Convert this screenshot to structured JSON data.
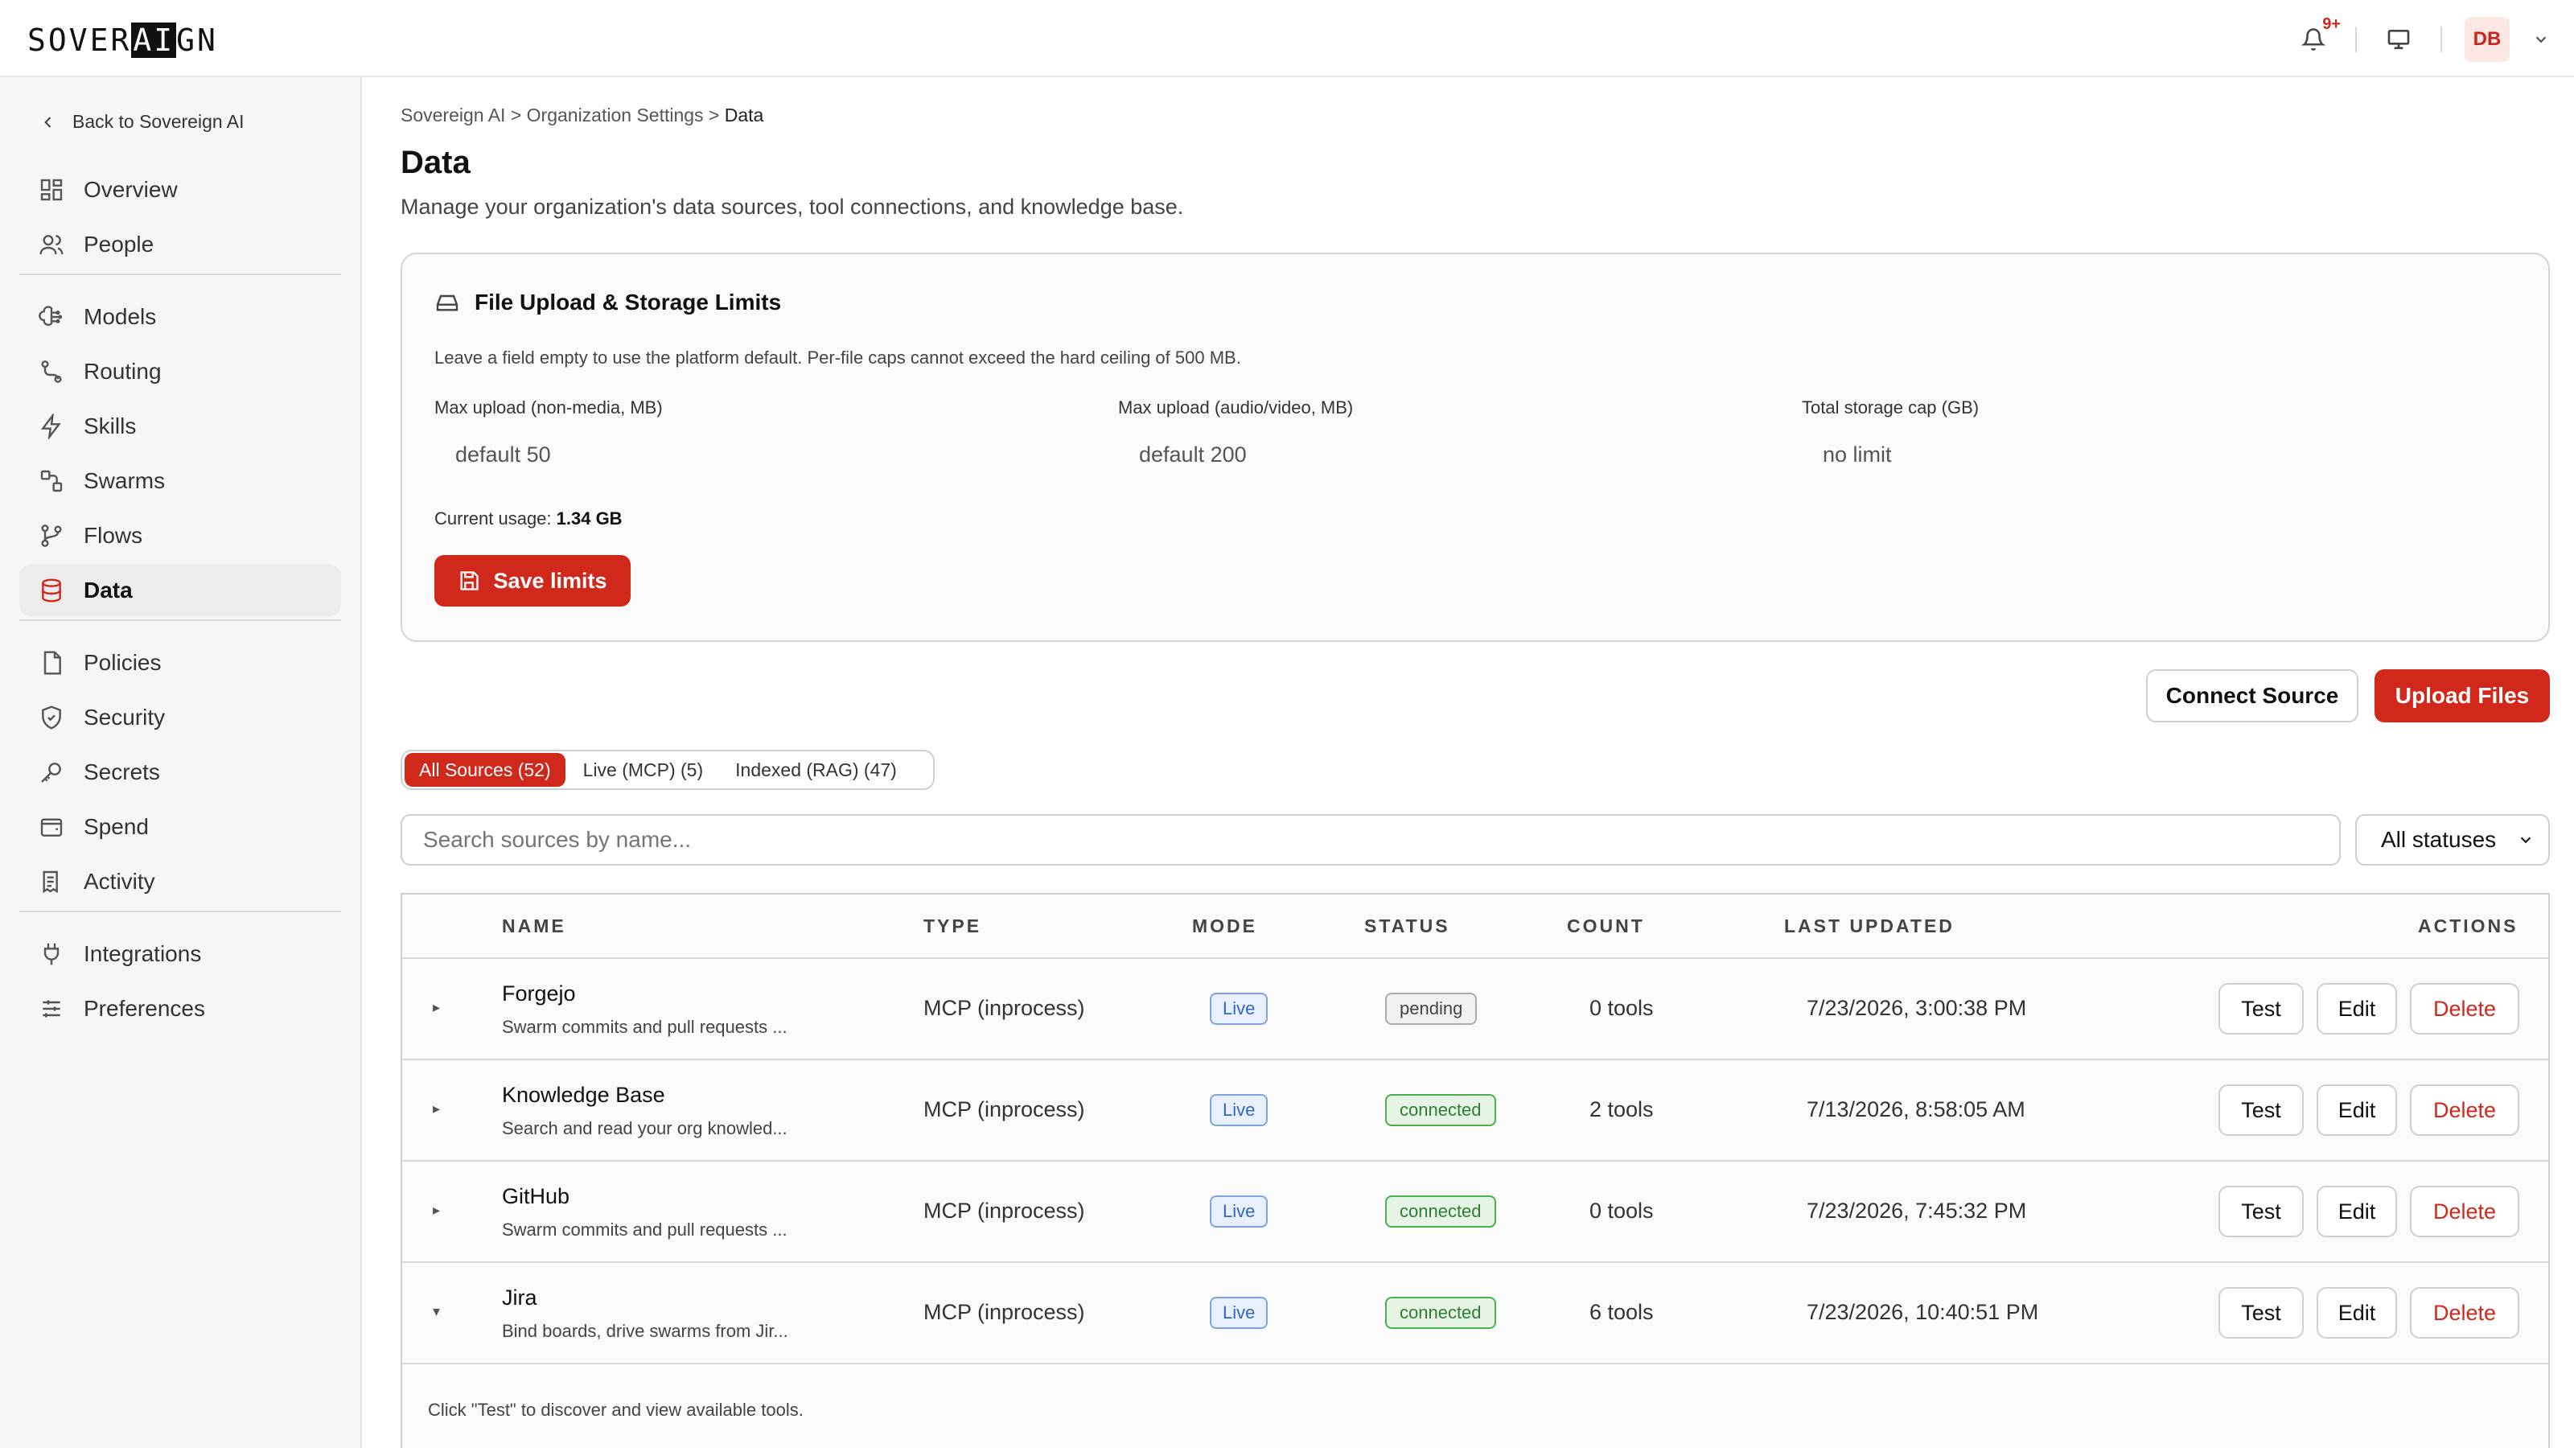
{
  "app": {
    "logo_pre": "SOVER",
    "logo_mid": "AI",
    "logo_post": "GN",
    "notif_badge": "9+",
    "avatar_initials": "DB"
  },
  "sidebar": {
    "back_label": "Back to Sovereign AI",
    "items": [
      {
        "label": "Overview",
        "icon": "grid-icon"
      },
      {
        "label": "People",
        "icon": "users-icon"
      },
      {
        "label": "Models",
        "icon": "brain-icon"
      },
      {
        "label": "Routing",
        "icon": "route-icon"
      },
      {
        "label": "Skills",
        "icon": "lightning-icon"
      },
      {
        "label": "Swarms",
        "icon": "swarm-icon"
      },
      {
        "label": "Flows",
        "icon": "branch-icon"
      },
      {
        "label": "Data",
        "icon": "database-icon",
        "active": true
      },
      {
        "label": "Policies",
        "icon": "document-icon"
      },
      {
        "label": "Security",
        "icon": "shield-icon"
      },
      {
        "label": "Secrets",
        "icon": "key-icon"
      },
      {
        "label": "Spend",
        "icon": "wallet-icon"
      },
      {
        "label": "Activity",
        "icon": "receipt-icon"
      },
      {
        "label": "Integrations",
        "icon": "plug-icon"
      },
      {
        "label": "Preferences",
        "icon": "sliders-icon"
      }
    ]
  },
  "breadcrumb": {
    "root": "Sovereign AI",
    "sep": ">",
    "parent": "Organization Settings",
    "current": "Data"
  },
  "page": {
    "title": "Data",
    "subtitle": "Manage your organization's data sources, tool connections, and knowledge base."
  },
  "limits": {
    "title": "File Upload & Storage Limits",
    "note": "Leave a field empty to use the platform default. Per-file caps cannot exceed the hard ceiling of 500 MB.",
    "fields": [
      {
        "label": "Max upload (non-media, MB)",
        "placeholder": "default 50"
      },
      {
        "label": "Max upload (audio/video, MB)",
        "placeholder": "default 200"
      },
      {
        "label": "Total storage cap (GB)",
        "placeholder": "no limit"
      }
    ],
    "usage_label": "Current usage: ",
    "usage_value": "1.34 GB",
    "save_label": "Save limits"
  },
  "actions": {
    "connect_label": "Connect Source",
    "upload_label": "Upload Files"
  },
  "tabs": [
    {
      "label": "All Sources (52)",
      "active": true
    },
    {
      "label": "Live (MCP) (5)"
    },
    {
      "label": "Indexed (RAG) (47)"
    }
  ],
  "search": {
    "placeholder": "Search sources by name..."
  },
  "status_filter": {
    "value": "All statuses"
  },
  "table": {
    "headers": {
      "name": "NAME",
      "type": "TYPE",
      "mode": "MODE",
      "status": "STATUS",
      "count": "COUNT",
      "updated": "LAST UPDATED",
      "actions": "ACTIONS"
    },
    "rows": [
      {
        "caret": "▸",
        "name": "Forgejo",
        "desc": "Swarm commits and pull requests ...",
        "type": "MCP (inprocess)",
        "mode": "Live",
        "status": "pending",
        "count": "0 tools",
        "updated": "7/23/2026, 3:00:38 PM"
      },
      {
        "caret": "▸",
        "name": "Knowledge Base",
        "desc": "Search and read your org knowled...",
        "type": "MCP (inprocess)",
        "mode": "Live",
        "status": "connected",
        "count": "2 tools",
        "updated": "7/13/2026, 8:58:05 AM"
      },
      {
        "caret": "▸",
        "name": "GitHub",
        "desc": "Swarm commits and pull requests ...",
        "type": "MCP (inprocess)",
        "mode": "Live",
        "status": "connected",
        "count": "0 tools",
        "updated": "7/23/2026, 7:45:32 PM"
      },
      {
        "caret": "▾",
        "name": "Jira",
        "desc": "Bind boards, drive swarms from Jir...",
        "type": "MCP (inprocess)",
        "mode": "Live",
        "status": "connected",
        "count": "6 tools",
        "updated": "7/23/2026, 10:40:51 PM"
      }
    ],
    "row_actions": {
      "test": "Test",
      "edit": "Edit",
      "delete": "Delete"
    },
    "footnote": "Click \"Test\" to discover and view available tools."
  },
  "colors": {
    "accent": "#d0281b",
    "live": "#3266c4",
    "connected": "#2e7d32"
  }
}
